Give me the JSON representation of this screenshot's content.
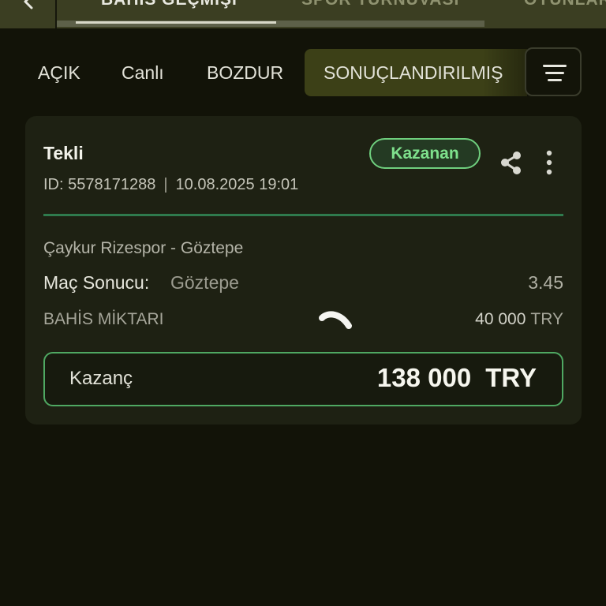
{
  "header": {
    "tabs": [
      {
        "label": "BAHİS GEÇMİŞİ"
      },
      {
        "label": "SPOR TURNUVASI"
      },
      {
        "label": "OYUNLAR"
      }
    ]
  },
  "filters": {
    "tabs": [
      {
        "label": "AÇIK"
      },
      {
        "label": "Canlı"
      },
      {
        "label": "BOZDUR"
      },
      {
        "label": "SONUÇLANDIRILMIŞ"
      }
    ],
    "active_index": 3
  },
  "bet": {
    "type": "Tekli",
    "status": "Kazanan",
    "id_text": "ID: 5578171288",
    "date": "10.08.2025 19:01",
    "match": "Çaykur Rizespor - Göztepe",
    "market_label": "Maç Sonucu:",
    "market_pick": "Göztepe",
    "odds": "3.45",
    "stake_label": "BAHİS MİKTARI",
    "stake_amount": "40 000",
    "stake_currency": "TRY",
    "win_label": "Kazanç",
    "win_amount": "138 000",
    "win_currency": "TRY"
  },
  "icons": {
    "back": "chevron-left-icon",
    "filter": "filter-lines-icon",
    "share": "share-icon",
    "more": "more-vertical-icon",
    "loading": "loading-spinner-icon"
  },
  "colors": {
    "background": "#121308",
    "header": "#3b3e22",
    "card": "#1e2113",
    "accent_green": "#6fcf7e",
    "divider": "#2f7a4d"
  }
}
